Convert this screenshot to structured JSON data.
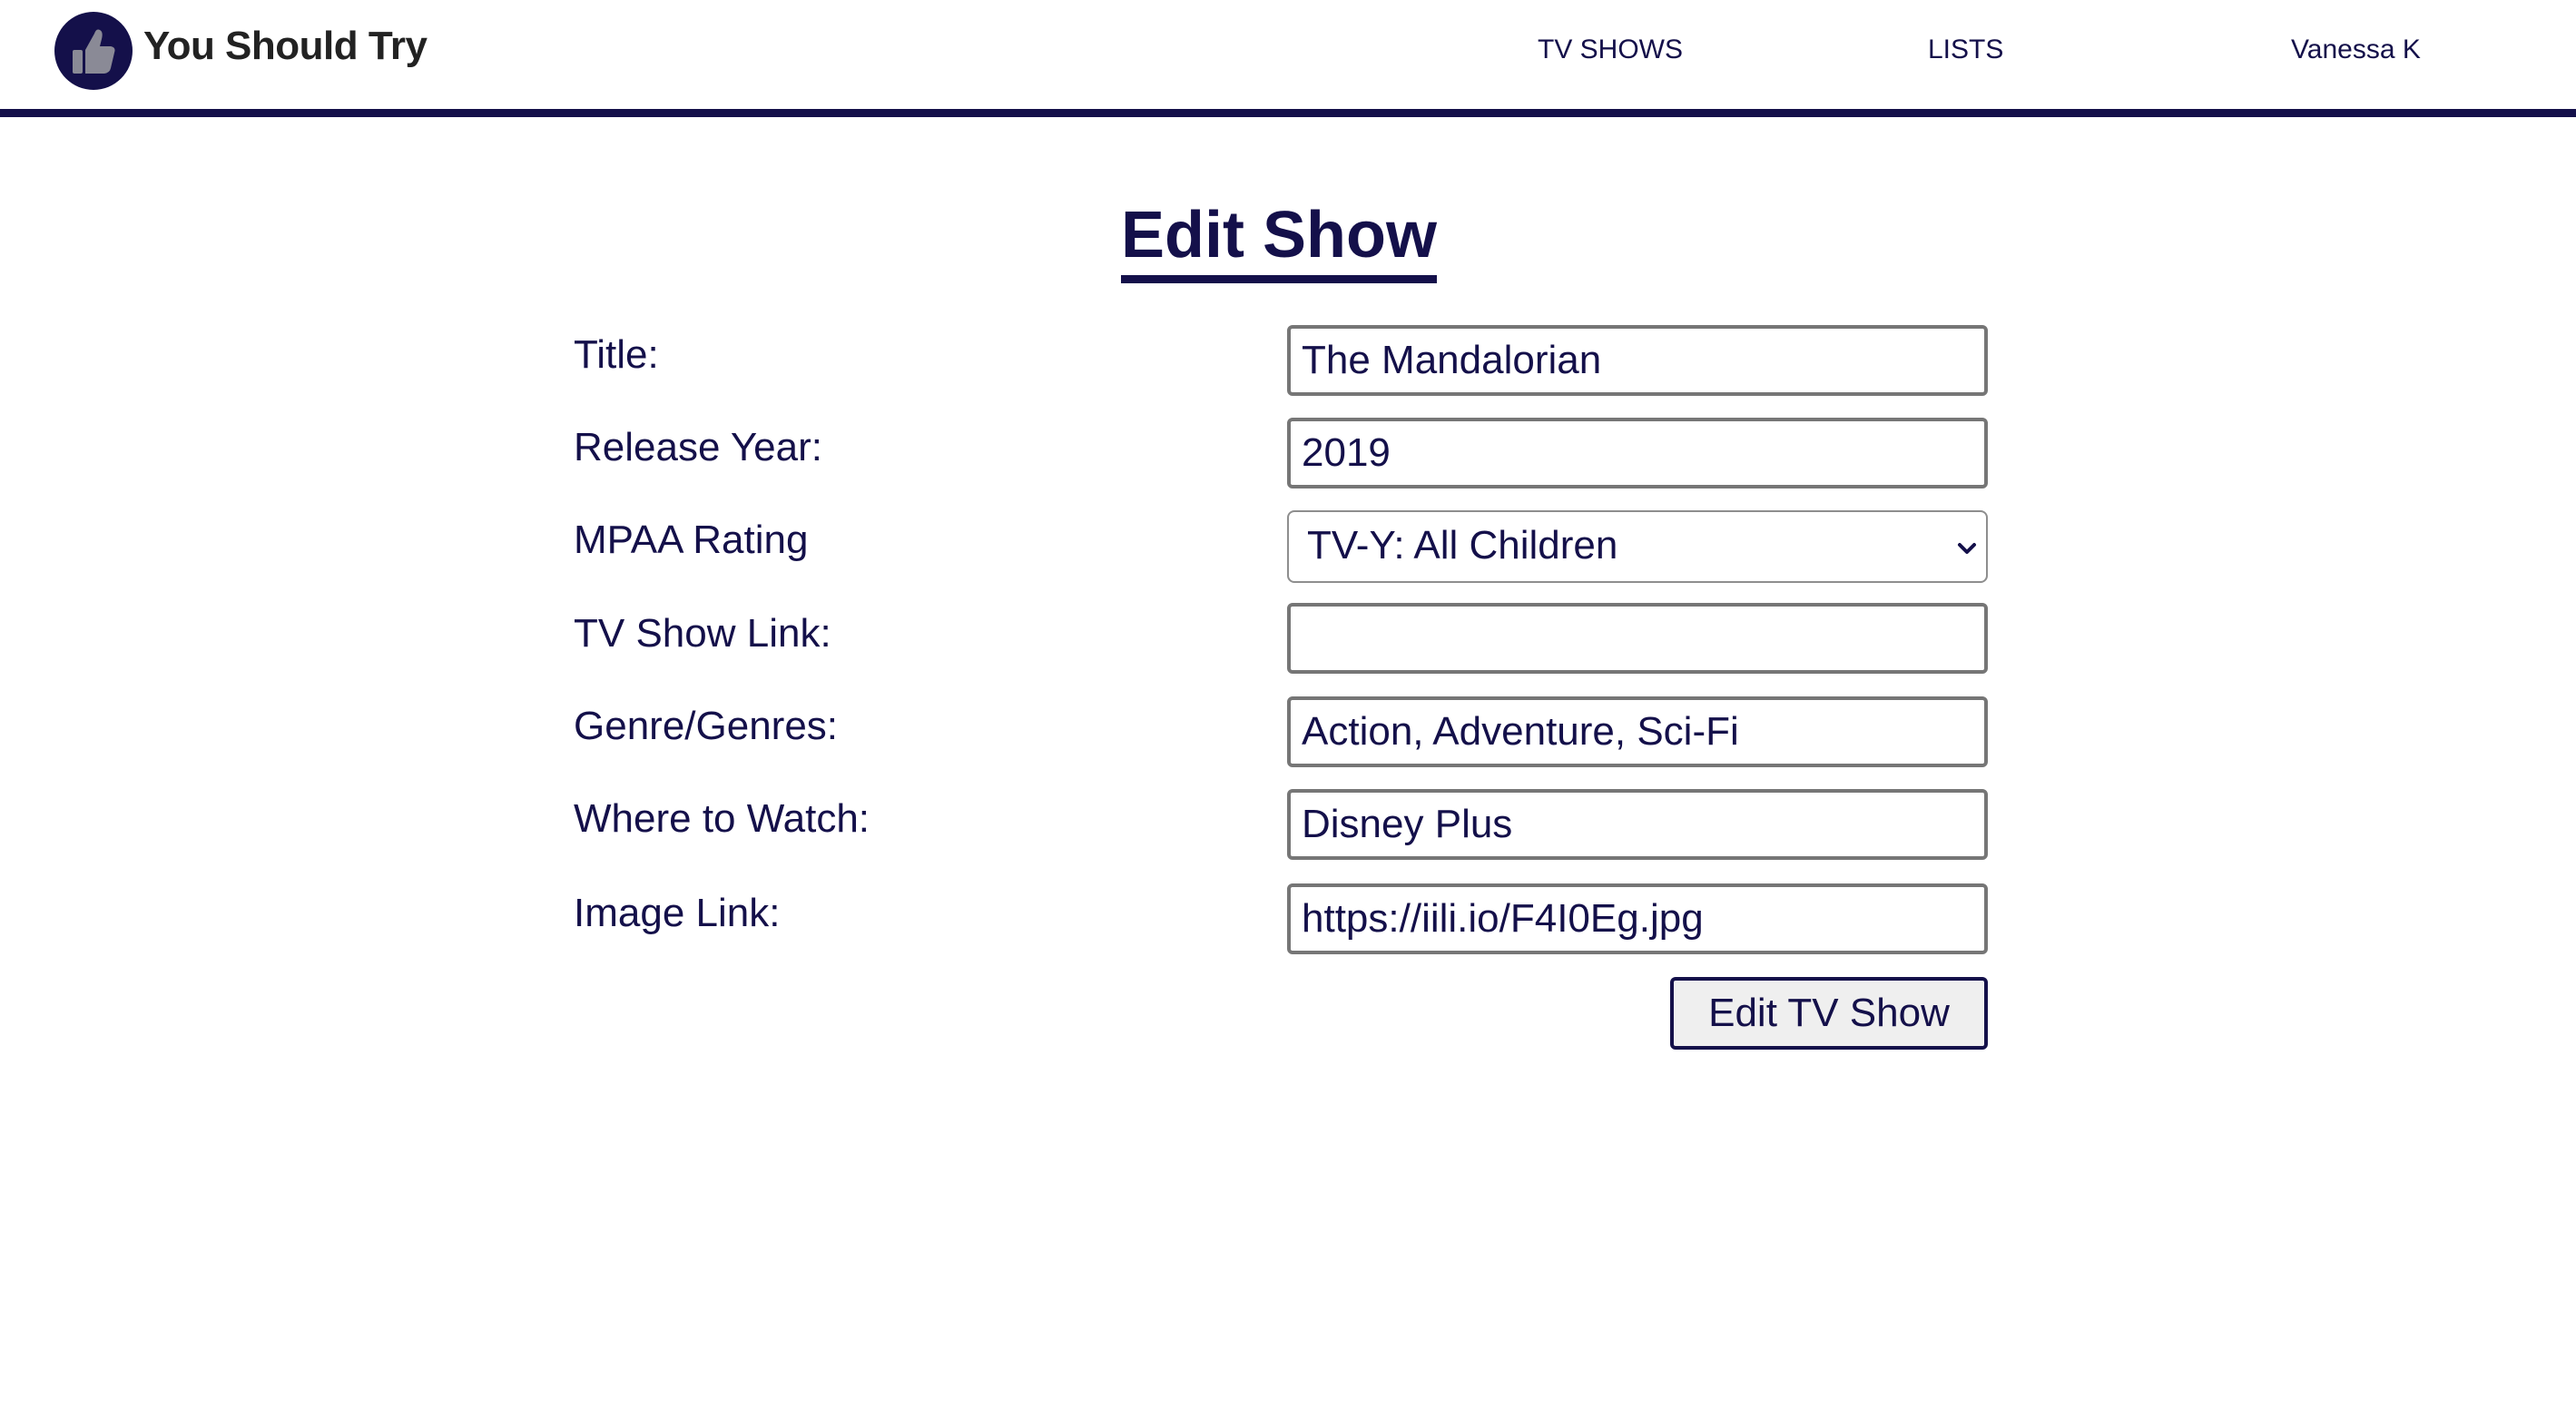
{
  "brand": {
    "name": "You Should Try",
    "logo_icon": "thumbs-up-icon"
  },
  "nav": {
    "tv_shows": "TV SHOWS",
    "lists": "LISTS",
    "user": "Vanessa K"
  },
  "page": {
    "title": "Edit Show"
  },
  "form": {
    "title": {
      "label": "Title:",
      "value": "The Mandalorian"
    },
    "release_year": {
      "label": "Release Year:",
      "value": "2019"
    },
    "mpaa_rating": {
      "label": "MPAA Rating",
      "selected": "TV-Y: All Children"
    },
    "tv_show_link": {
      "label": "TV Show Link:",
      "value": ""
    },
    "genres": {
      "label": "Genre/Genres:",
      "value": "Action, Adventure, Sci-Fi"
    },
    "where_to_watch": {
      "label": "Where to Watch:",
      "value": "Disney Plus"
    },
    "image_link": {
      "label": "Image Link:",
      "value": "https://iili.io/F4I0Eg.jpg"
    },
    "submit_label": "Edit TV Show"
  },
  "colors": {
    "primary": "#14104a",
    "brand_text": "#222222",
    "button_bg": "#efefef"
  }
}
